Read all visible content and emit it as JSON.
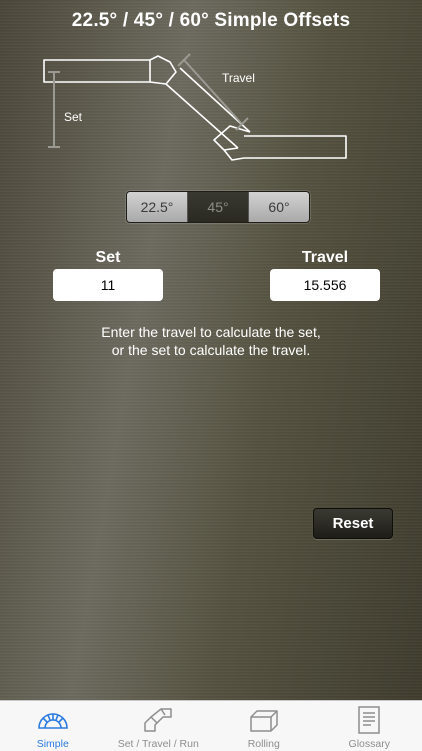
{
  "header": {
    "title": "22.5° / 45° / 60° Simple Offsets"
  },
  "diagram": {
    "travel_label": "Travel",
    "set_label": "Set"
  },
  "angle_selector": {
    "options": [
      "22.5°",
      "45°",
      "60°"
    ],
    "selected": "45°"
  },
  "set_field": {
    "label": "Set",
    "value": "11"
  },
  "travel_field": {
    "label": "Travel",
    "value": "15.556"
  },
  "hint": {
    "line1": "Enter the travel to calculate the set,",
    "line2": "or the set to calculate the travel."
  },
  "reset_label": "Reset",
  "tabs": [
    {
      "label": "Simple",
      "icon": "protractor-icon",
      "active": true
    },
    {
      "label": "Set / Travel / Run",
      "icon": "pipe-offset-icon",
      "active": false
    },
    {
      "label": "Rolling",
      "icon": "box-icon",
      "active": false
    },
    {
      "label": "Glossary",
      "icon": "document-icon",
      "active": false
    }
  ],
  "colors": {
    "active_tab": "#2b7be0",
    "inactive_tab": "#8e8e8e"
  }
}
